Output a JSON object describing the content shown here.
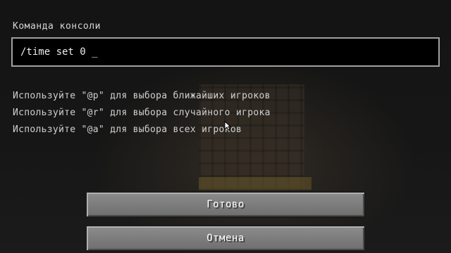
{
  "console": {
    "title": "Команда консоли",
    "command_value": "/time set 0",
    "caret": "_"
  },
  "hints": [
    "Используйте \"@p\" для выбора ближайших игроков",
    "Используйте \"@r\" для выбора случайного игрока",
    "Используйте \"@a\" для выбора всех игроков"
  ],
  "buttons": {
    "done_label": "Готово",
    "cancel_label": "Отмена"
  },
  "colors": {
    "button_face": "#7d7d7d",
    "input_border": "#a0a0a0",
    "input_bg": "#000000",
    "text": "#e0e0e0"
  },
  "icons": {
    "mouse_pointer": "arrow-cursor-icon"
  }
}
